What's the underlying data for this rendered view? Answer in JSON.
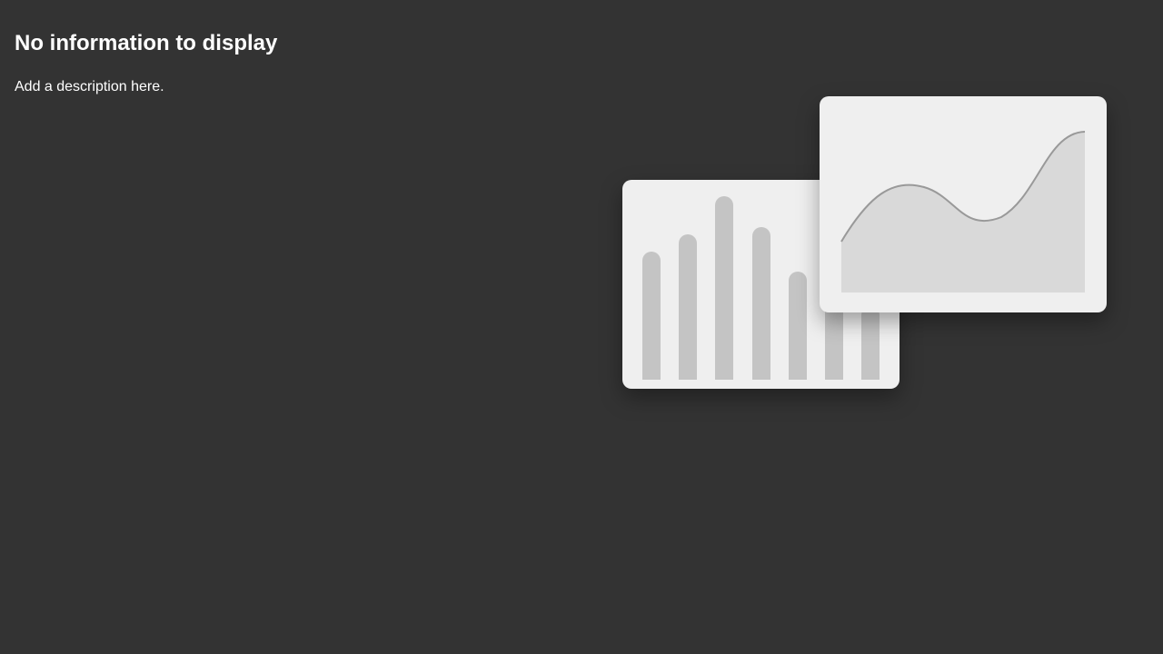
{
  "empty_state": {
    "title": "No information to display",
    "description": "Add a description here."
  },
  "illustration": {
    "bar_values": [
      0.7,
      0.79,
      1.0,
      0.83,
      0.59,
      0.47,
      0.4
    ],
    "bar_color": "#c4c4c4",
    "line_color": "#999999",
    "area_color": "#d9d9d9",
    "card_color": "#efefef"
  }
}
